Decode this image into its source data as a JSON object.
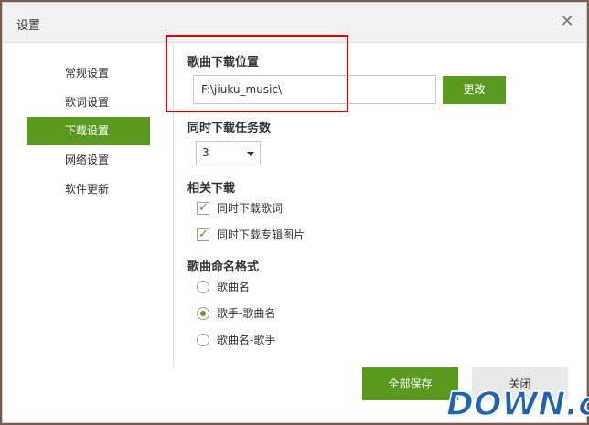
{
  "window": {
    "title": "设置"
  },
  "sidebar": {
    "items": [
      {
        "label": "常规设置",
        "active": false
      },
      {
        "label": "歌词设置",
        "active": false
      },
      {
        "label": "下载设置",
        "active": true
      },
      {
        "label": "网络设置",
        "active": false
      },
      {
        "label": "软件更新",
        "active": false
      }
    ]
  },
  "download_location": {
    "title": "歌曲下载位置",
    "path": "F:\\jiuku_music\\",
    "change_label": "更改"
  },
  "concurrent": {
    "title": "同时下载任务数",
    "selected": "3"
  },
  "related": {
    "title": "相关下载",
    "options": [
      {
        "label": "同时下载歌词",
        "checked": true
      },
      {
        "label": "同时下载专辑图片",
        "checked": true
      }
    ]
  },
  "naming": {
    "title": "歌曲命名格式",
    "options": [
      {
        "label": "歌曲名",
        "selected": false
      },
      {
        "label": "歌手-歌曲名",
        "selected": true
      },
      {
        "label": "歌曲名-歌手",
        "selected": false
      }
    ]
  },
  "footer": {
    "save_label": "全部保存",
    "close_label": "关闭"
  },
  "watermark": {
    "text": "DOWN.cc"
  },
  "colors": {
    "accent": "#5a9b1f",
    "highlight": "#e00000"
  }
}
